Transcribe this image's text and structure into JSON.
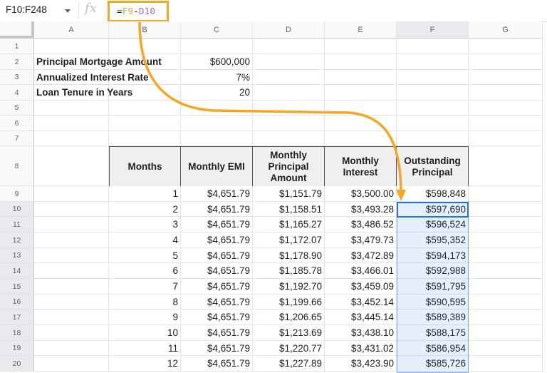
{
  "formula_bar": {
    "name_box": "F10:F248",
    "fx_icon": "fx",
    "formula_prefix": "=",
    "formula_ref1": "F9",
    "formula_op": "-",
    "formula_ref2": "D10"
  },
  "columns": [
    "A",
    "B",
    "C",
    "D",
    "E",
    "F",
    "G"
  ],
  "selected_column": "F",
  "rows": [
    "1",
    "2",
    "3",
    "4",
    "5",
    "6",
    "7",
    "8",
    "9",
    "10",
    "11",
    "12",
    "13",
    "14",
    "15",
    "16",
    "17",
    "18",
    "19",
    "20"
  ],
  "inputs": [
    {
      "label": "Principal Mortgage Amount",
      "value": "$600,000"
    },
    {
      "label": "Annualized Interest Rate",
      "value": "7%"
    },
    {
      "label": "Loan Tenure in Years",
      "value": "20"
    }
  ],
  "table": {
    "headers": [
      "Months",
      "Monthly EMI",
      "Monthly Principal Amount",
      "Monthly Interest",
      "Outstanding Principal"
    ],
    "rows": [
      [
        "1",
        "$4,651.79",
        "$1,151.79",
        "$3,500.00",
        "$598,848"
      ],
      [
        "2",
        "$4,651.79",
        "$1,158.51",
        "$3,493.28",
        "$597,690"
      ],
      [
        "3",
        "$4,651.79",
        "$1,165.27",
        "$3,486.52",
        "$596,524"
      ],
      [
        "4",
        "$4,651.79",
        "$1,172.07",
        "$3,479.73",
        "$595,352"
      ],
      [
        "5",
        "$4,651.79",
        "$1,178.90",
        "$3,472.89",
        "$594,173"
      ],
      [
        "6",
        "$4,651.79",
        "$1,185.78",
        "$3,466.01",
        "$592,988"
      ],
      [
        "7",
        "$4,651.79",
        "$1,192.70",
        "$3,459.09",
        "$591,795"
      ],
      [
        "8",
        "$4,651.79",
        "$1,199.66",
        "$3,452.14",
        "$590,595"
      ],
      [
        "9",
        "$4,651.79",
        "$1,206.65",
        "$3,445.14",
        "$589,389"
      ],
      [
        "10",
        "$4,651.79",
        "$1,213.69",
        "$3,438.10",
        "$588,175"
      ],
      [
        "11",
        "$4,651.79",
        "$1,220.77",
        "$3,431.02",
        "$586,954"
      ],
      [
        "12",
        "$4,651.79",
        "$1,227.89",
        "$3,423.90",
        "$585,726"
      ]
    ]
  },
  "colors": {
    "annotation": "#f5a623",
    "selection_border": "#1a73e8",
    "ref1": "#e8a33b",
    "ref2": "#a05fc0"
  }
}
